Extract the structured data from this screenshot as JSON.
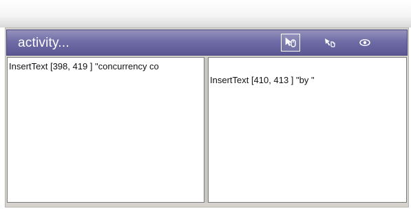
{
  "panel": {
    "title": "activity...",
    "header_buttons": [
      {
        "icon": "mouse-cursor-icon",
        "selected": true
      },
      {
        "icon": "hand-pointer-icon",
        "selected": false
      },
      {
        "icon": "eye-icon",
        "selected": false
      }
    ]
  },
  "left_pane": {
    "text": "InsertText [398, 419 ] \"concurrency co"
  },
  "right_pane": {
    "text": "InsertText [410, 413 ] \"by \""
  },
  "colors": {
    "header_top": "#9592bd",
    "header_bottom": "#5a5793",
    "panel_bg": "#d6d3ce"
  }
}
